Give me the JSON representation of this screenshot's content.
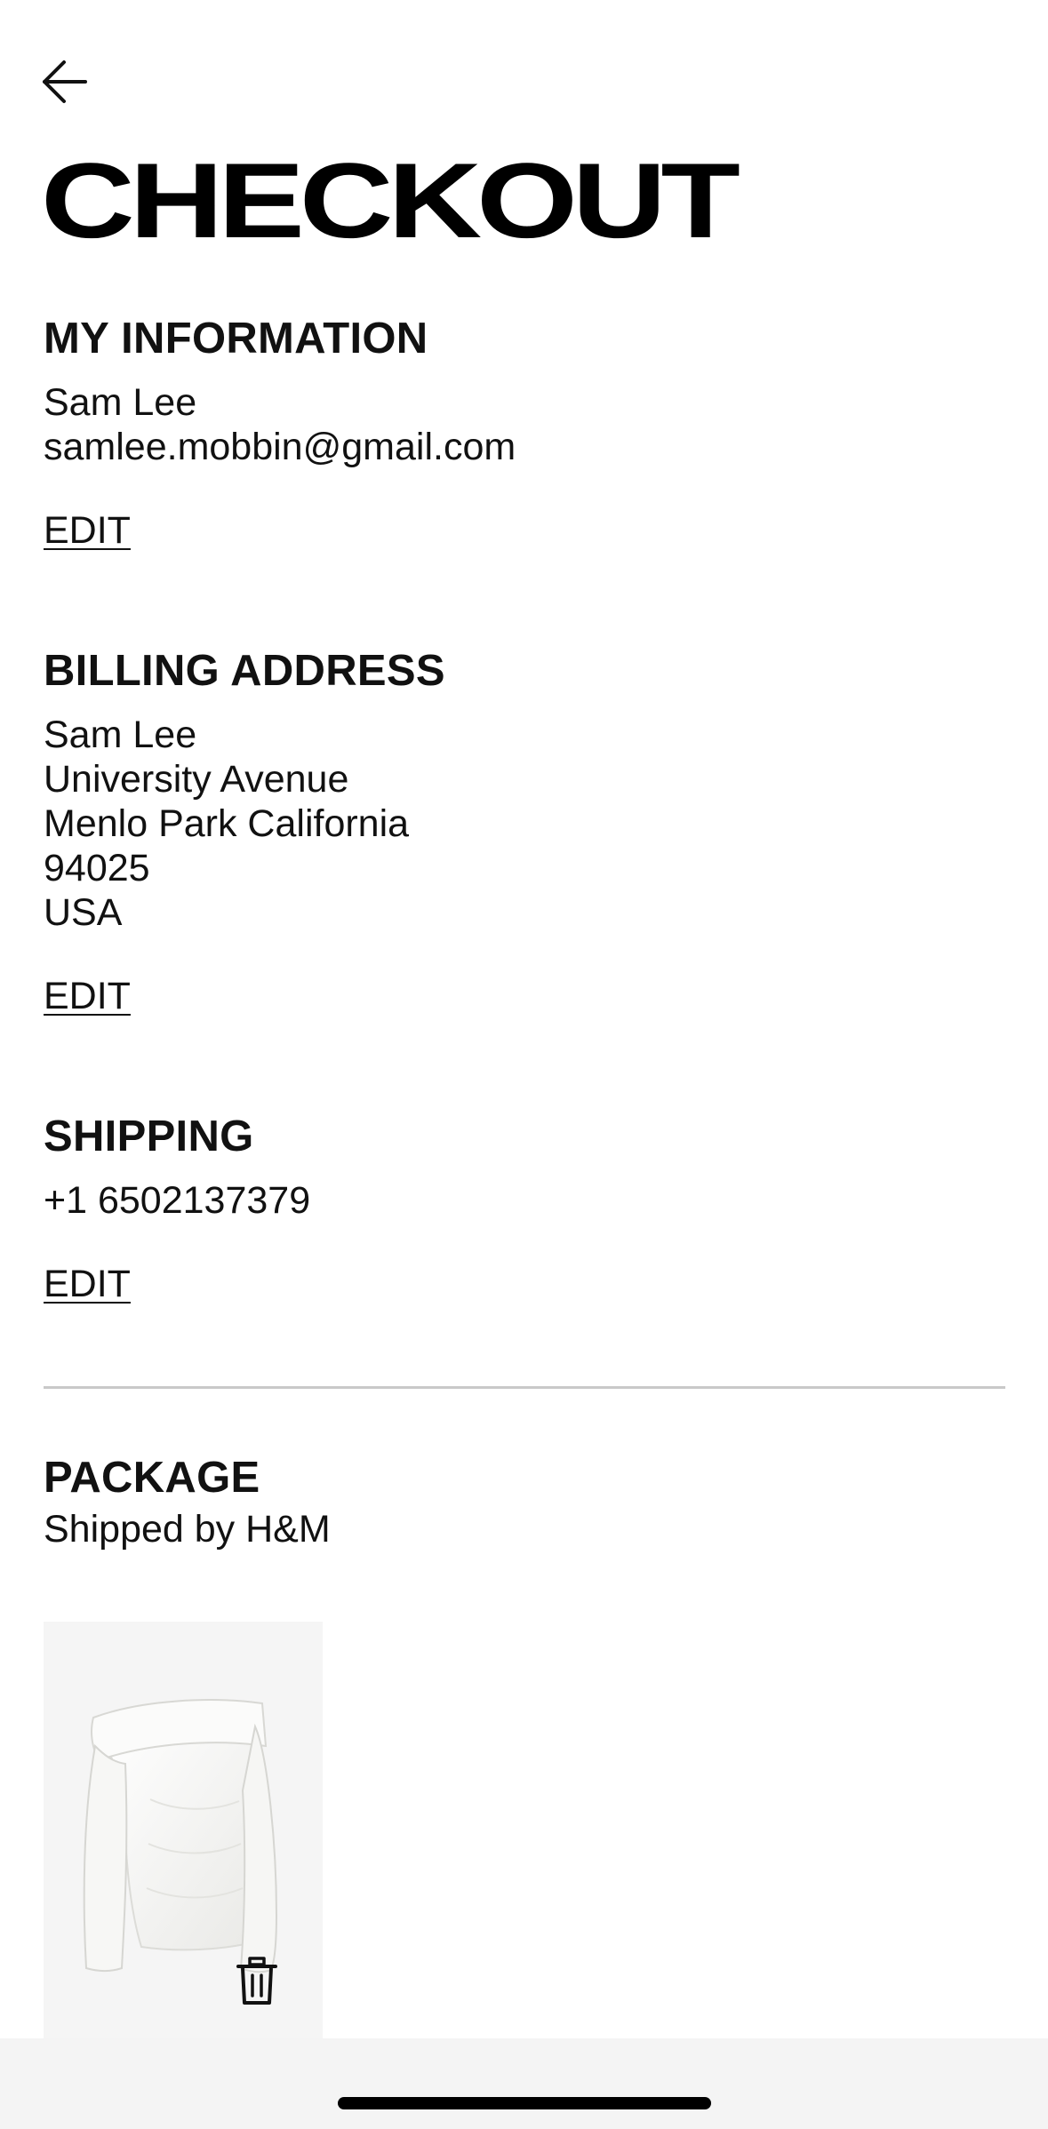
{
  "header": {
    "back_icon": "arrow-left-icon",
    "title": "CHECKOUT"
  },
  "my_information": {
    "heading": "MY INFORMATION",
    "name": "Sam Lee",
    "email": "samlee.mobbin@gmail.com",
    "edit_label": "EDIT"
  },
  "billing_address": {
    "heading": "BILLING ADDRESS",
    "lines": [
      "Sam Lee",
      "University Avenue",
      "Menlo Park California",
      "94025",
      "USA"
    ],
    "edit_label": "EDIT"
  },
  "shipping": {
    "heading": "SHIPPING",
    "phone": "+1 6502137379",
    "edit_label": "EDIT"
  },
  "package": {
    "heading": "PACKAGE",
    "subtitle": "Shipped by H&M",
    "item": {
      "image": "white off-shoulder long-sleeve top",
      "delete_icon": "trash-icon"
    }
  },
  "colors": {
    "text": "#111111",
    "background": "#ffffff",
    "divider": "#c9c9c9",
    "product_card_bg": "#f5f5f5"
  }
}
